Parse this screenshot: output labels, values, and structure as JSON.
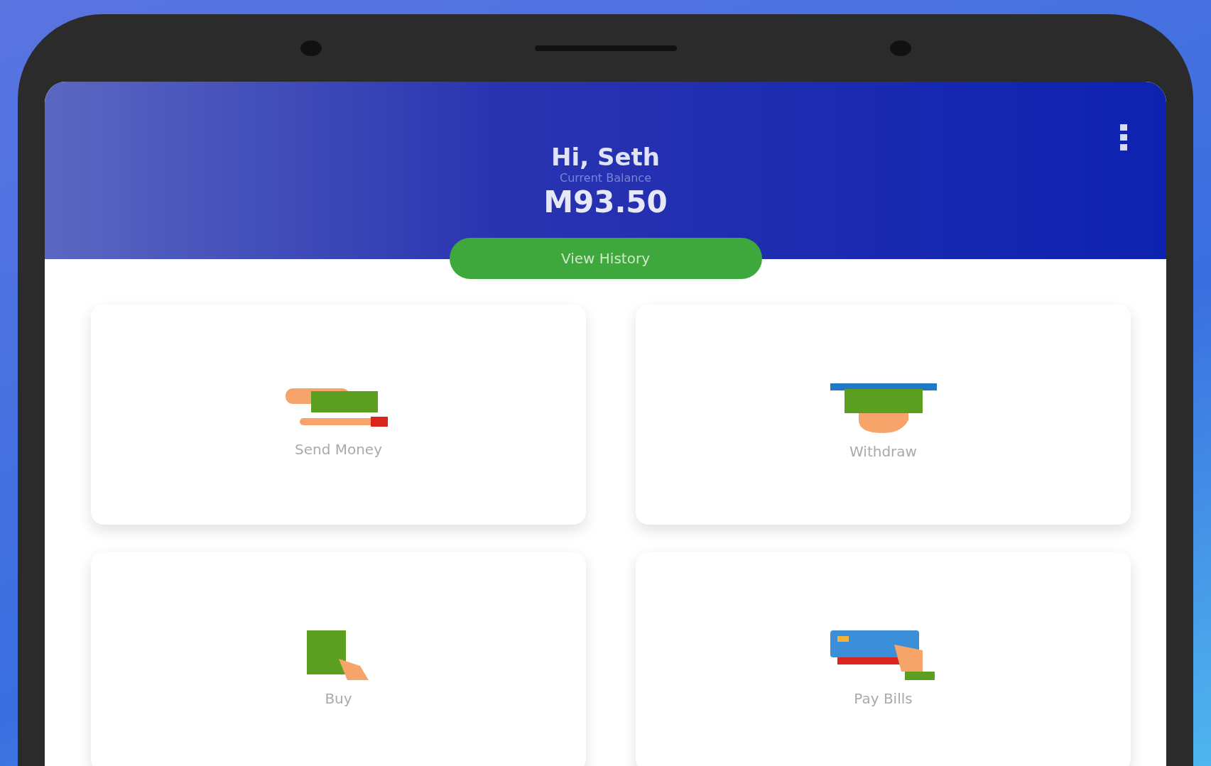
{
  "header": {
    "greeting": "Hi, Seth",
    "balance_label": "Current Balance",
    "balance": "M93.50",
    "history_button": "View History"
  },
  "actions": [
    {
      "label": "Send Money",
      "kind": "send"
    },
    {
      "label": "Withdraw",
      "kind": "withdraw"
    },
    {
      "label": "Buy",
      "kind": "buy"
    },
    {
      "label": "Pay Bills",
      "kind": "bills"
    }
  ]
}
